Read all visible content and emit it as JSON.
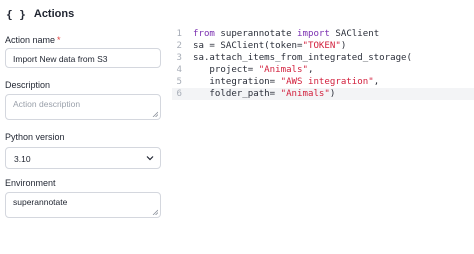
{
  "header": {
    "icon": "{ }",
    "icon_name": "braces-icon",
    "title": "Actions"
  },
  "form": {
    "action_name": {
      "label": "Action name",
      "required_mark": "*",
      "value": "Import New data from S3"
    },
    "description": {
      "label": "Description",
      "placeholder": "Action description"
    },
    "python_version": {
      "label": "Python version",
      "value": "3.10"
    },
    "environment": {
      "label": "Environment",
      "value": "superannotate"
    }
  },
  "editor": {
    "active_line": 6,
    "lines": [
      {
        "num": "1",
        "tokens": [
          {
            "t": "from",
            "k": "kw"
          },
          {
            "t": " superannotate ",
            "k": "plain"
          },
          {
            "t": "import",
            "k": "kw"
          },
          {
            "t": " SAClient",
            "k": "plain"
          }
        ]
      },
      {
        "num": "2",
        "tokens": [
          {
            "t": "sa = SAClient(token=",
            "k": "plain"
          },
          {
            "t": "\"TOKEN\"",
            "k": "str"
          },
          {
            "t": ")",
            "k": "plain"
          }
        ]
      },
      {
        "num": "3",
        "tokens": [
          {
            "t": "sa.attach_items_from_integrated_storage(",
            "k": "plain"
          }
        ]
      },
      {
        "num": "4",
        "tokens": [
          {
            "t": "   project= ",
            "k": "plain"
          },
          {
            "t": "\"Animals\"",
            "k": "str"
          },
          {
            "t": ",",
            "k": "plain"
          }
        ]
      },
      {
        "num": "5",
        "tokens": [
          {
            "t": "   integration= ",
            "k": "plain"
          },
          {
            "t": "\"AWS integration\"",
            "k": "str"
          },
          {
            "t": ",",
            "k": "plain"
          }
        ]
      },
      {
        "num": "6",
        "tokens": [
          {
            "t": "   folder_path= ",
            "k": "plain"
          },
          {
            "t": "\"Animals\"",
            "k": "str"
          },
          {
            "t": ")",
            "k": "plain"
          }
        ]
      }
    ]
  },
  "colors": {
    "keyword": "#7a2fb0",
    "string": "#d21f3c",
    "required": "#e0413e",
    "border": "#d4d7de",
    "active_line_bg": "#f3f4f6"
  }
}
